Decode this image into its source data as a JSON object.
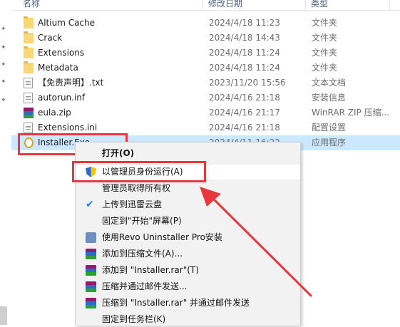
{
  "header": {
    "col_name": "名称",
    "col_date": "修改日期",
    "col_type": "类型"
  },
  "files": [
    {
      "name": "Altium Cache",
      "date": "2024/4/18 11:23",
      "type": "文件夹",
      "icon": "folder-icon"
    },
    {
      "name": "Crack",
      "date": "2024/4/18 14:43",
      "type": "文件夹",
      "icon": "folder-icon"
    },
    {
      "name": "Extensions",
      "date": "2024/4/18 11:24",
      "type": "文件夹",
      "icon": "folder-icon"
    },
    {
      "name": "Metadata",
      "date": "2024/4/18 11:24",
      "type": "文件夹",
      "icon": "folder-icon"
    },
    {
      "name": "【免责声明】.txt",
      "date": "2023/11/20 15:56",
      "type": "文本文档",
      "icon": "text-file-icon"
    },
    {
      "name": "autorun.inf",
      "date": "2024/4/16 21:18",
      "type": "安装信息",
      "icon": "settings-file-icon"
    },
    {
      "name": "eula.zip",
      "date": "2024/4/16 21:17",
      "type": "WinRAR ZIP 压缩...",
      "icon": "winrar-zip-icon"
    },
    {
      "name": "Extensions.ini",
      "date": "2024/4/16 21:18",
      "type": "配置设置",
      "icon": "settings-file-icon"
    },
    {
      "name": "Installer.Exe",
      "date": "2024/4/11 16:22",
      "type": "应用程序",
      "icon": "installer-exe-icon"
    }
  ],
  "context_menu": {
    "items": [
      {
        "label": "打开(O)",
        "icon": "",
        "bold": true
      },
      {
        "label": "以管理员身份运行(A)",
        "icon": "uac-shield-icon"
      },
      {
        "label": "管理员取得所有权",
        "icon": ""
      },
      {
        "label": "上传到迅雷云盘",
        "icon": "thunder-cloud-icon"
      },
      {
        "label": "固定到\"开始\"屏幕(P)",
        "icon": ""
      },
      {
        "label": "使用Revo Uninstaller Pro安装",
        "icon": "revo-uninstaller-icon"
      },
      {
        "label": "添加到压缩文件(A)...",
        "icon": "winrar-icon"
      },
      {
        "label": "添加到 \"Installer.rar\"(T)",
        "icon": "winrar-icon"
      },
      {
        "label": "压缩并通过邮件发送...",
        "icon": "winrar-icon"
      },
      {
        "label": "压缩到 \"Installer.rar\" 并通过邮件发送",
        "icon": "winrar-icon"
      },
      {
        "label": "固定到任务栏(K)",
        "icon": ""
      }
    ]
  },
  "colors": {
    "annotation_red": "#e8383d",
    "selection_blue": "#cce8ff",
    "menu_bg": "#f2f2f2"
  }
}
